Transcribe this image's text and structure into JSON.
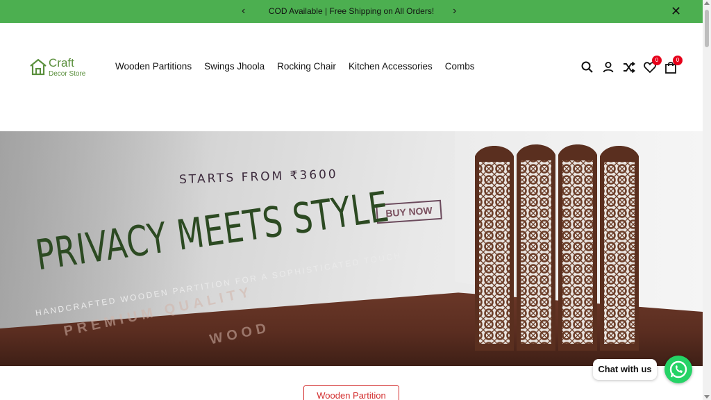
{
  "announcement": {
    "message": "COD Available | Free Shipping on All Orders!",
    "prev_icon": "chevron-left-icon",
    "next_icon": "chevron-right-icon",
    "close_icon": "close-icon",
    "bg_color": "#4caf50"
  },
  "header": {
    "logo": {
      "line1": "Craft",
      "line2": "Decor Store",
      "color": "#5a8f3c"
    },
    "nav": [
      {
        "label": "Wooden Partitions"
      },
      {
        "label": "Swings Jhoola"
      },
      {
        "label": "Rocking Chair"
      },
      {
        "label": "Kitchen Accessories"
      },
      {
        "label": "Combs"
      }
    ],
    "icons": {
      "search": "search-icon",
      "account": "user-icon",
      "compare": "shuffle-icon",
      "wishlist": "heart-icon",
      "cart": "bag-icon"
    },
    "wishlist_count": "0",
    "cart_count": "0"
  },
  "hero": {
    "starts_from": "STARTS FROM ₹3600",
    "cta": "BUY NOW",
    "headline": "PRIVACY MEETS STYLE",
    "subline": "HANDCRAFTED WOODEN PARTITION FOR A SOPHISTICATED TOUCH",
    "floor_text_1": "PREMIUM QUALITY",
    "floor_text_2": "WOOD"
  },
  "chat": {
    "label": "Chat with us",
    "icon": "whatsapp-icon",
    "color": "#25d366"
  },
  "category_button": {
    "label": "Wooden Partition",
    "color": "#d32f2f"
  }
}
